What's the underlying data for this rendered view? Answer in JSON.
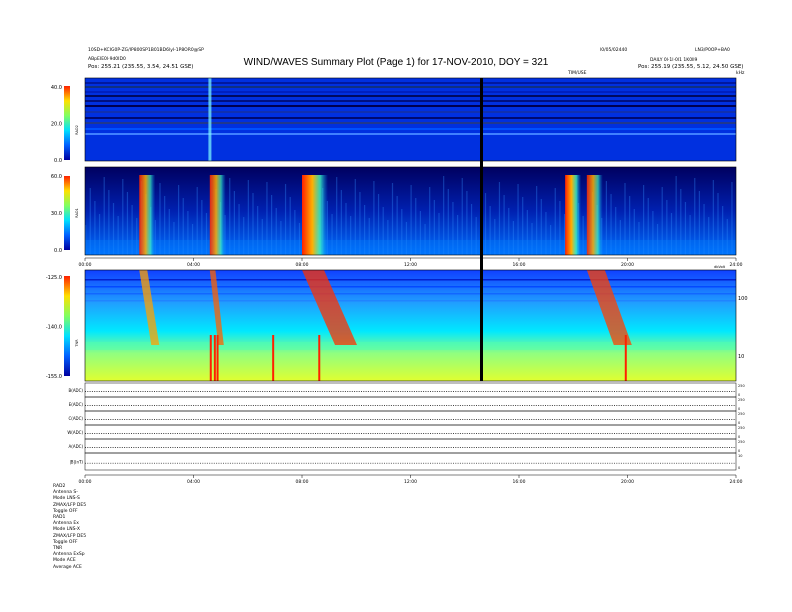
{
  "header": {
    "title": "WIND/WAVES Summary Plot (Page 1) for 17-NOV-2010, DOY = 321",
    "left_line1": "10SD+KCIG0P-ZG/IP800SP1B01BD6lyl-1P8OR0@SP",
    "left_line2": "ABpEIE0l·9d0ID0",
    "left_line3": "Pos:  255.21 (235.55, 3.54, 24.51 GSE)",
    "right_line1": "l0/05/02440",
    "right_line2": "LN3/P0OP+BA0",
    "right_line3": "DAILY  0l·1l·0l1 1K0ll9",
    "right_line4": "Pos:  255.19 (235.55, 5.12, 24.50 GSE)",
    "top_axis_label": "TIM/USE",
    "top_axis_right": "kHz"
  },
  "panels": {
    "rad2": {
      "label": "RAD2",
      "ticks": [
        "40.0",
        "20.0",
        "0.0"
      ]
    },
    "rad1": {
      "label": "RAD1",
      "ticks": [
        "60.0",
        "30.0",
        "0.0"
      ]
    },
    "tnr": {
      "label": "TNR",
      "ticks": [
        "-125.0",
        "-140.0",
        "-155.0"
      ],
      "right_ticks": [
        "100",
        "10"
      ],
      "right_label": "dbVolt"
    },
    "time_ticks": [
      "00:00",
      "04:00",
      "08:00",
      "12:00",
      "16:00",
      "20:00",
      "24:00"
    ],
    "line_panels": [
      {
        "label": "B(ADC)",
        "r1": "250",
        "r2": "0"
      },
      {
        "label": "E(ADC)",
        "r1": "250",
        "r2": "0"
      },
      {
        "label": "C(ADC)",
        "r1": "250",
        "r2": "0"
      },
      {
        "label": "W(ADC)",
        "r1": "250",
        "r2": "0"
      },
      {
        "label": "A(ADC)",
        "r1": "250",
        "r2": "0"
      },
      {
        "label": "|B|(nT)",
        "r1": "10",
        "r2": "0"
      }
    ]
  },
  "footer": [
    "RAD2",
    "Antenna    S-",
    "Mode    LNS-S",
    "ZMAX/LFP  DE5",
    "Toggle     OFF",
    "RAD1",
    "Antenna    Ex",
    "Mode   LNS-X",
    "ZMAX/LFP  DE5",
    "Toggle     OFF",
    "TNR",
    "Antenna   ExSp",
    "Mode     ACE",
    "Average    ACE"
  ],
  "colors": {
    "accent": "#0033ff"
  },
  "chart_data": {
    "type": "heatmap",
    "title": "WIND/WAVES Summary Plot (Page 1) for 17-NOV-2010, DOY = 321",
    "x_range_hours": [
      0,
      24
    ],
    "panels": [
      "RAD2",
      "RAD1",
      "TNR",
      "B(ADC)",
      "E(ADC)",
      "C(ADC)",
      "W(ADC)",
      "A(ADC)",
      "|B|(nT)"
    ],
    "rad2_range": [
      0,
      40
    ],
    "rad1_range": [
      0,
      60
    ],
    "tnr_range": [
      -155,
      -125
    ],
    "bursts_hours": [
      2.0,
      4.6,
      8.0,
      17.7,
      18.5
    ]
  }
}
